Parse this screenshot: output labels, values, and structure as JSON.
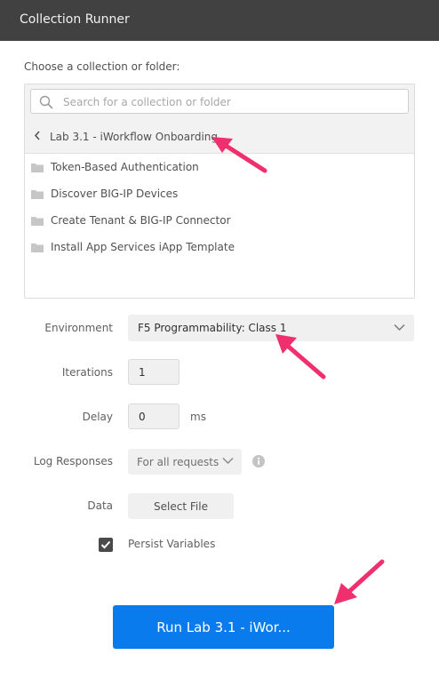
{
  "window": {
    "title": "Collection Runner"
  },
  "picker": {
    "label": "Choose a collection or folder:",
    "search_placeholder": "Search for a collection or folder",
    "breadcrumb": "Lab 3.1 - iWorkflow Onboarding",
    "items": [
      {
        "label": "Token-Based Authentication",
        "icon": "folder-icon"
      },
      {
        "label": "Discover BIG-IP Devices",
        "icon": "folder-icon"
      },
      {
        "label": "Create Tenant & BIG-IP Connector",
        "icon": "folder-icon"
      },
      {
        "label": "Install App Services iApp Template",
        "icon": "folder-icon"
      }
    ]
  },
  "form": {
    "environment": {
      "label": "Environment",
      "value": "F5 Programmability: Class 1"
    },
    "iterations": {
      "label": "Iterations",
      "value": "1"
    },
    "delay": {
      "label": "Delay",
      "value": "0",
      "unit": "ms"
    },
    "log_responses": {
      "label": "Log Responses",
      "value": "For all requests"
    },
    "data": {
      "label": "Data",
      "button": "Select File"
    },
    "persist": {
      "label": "Persist Variables",
      "checked": true
    }
  },
  "run_button": {
    "label": "Run Lab 3.1 - iWor..."
  },
  "colors": {
    "titlebar": "#414141",
    "primary": "#097bed",
    "annotation_arrow": "#f0306e"
  }
}
